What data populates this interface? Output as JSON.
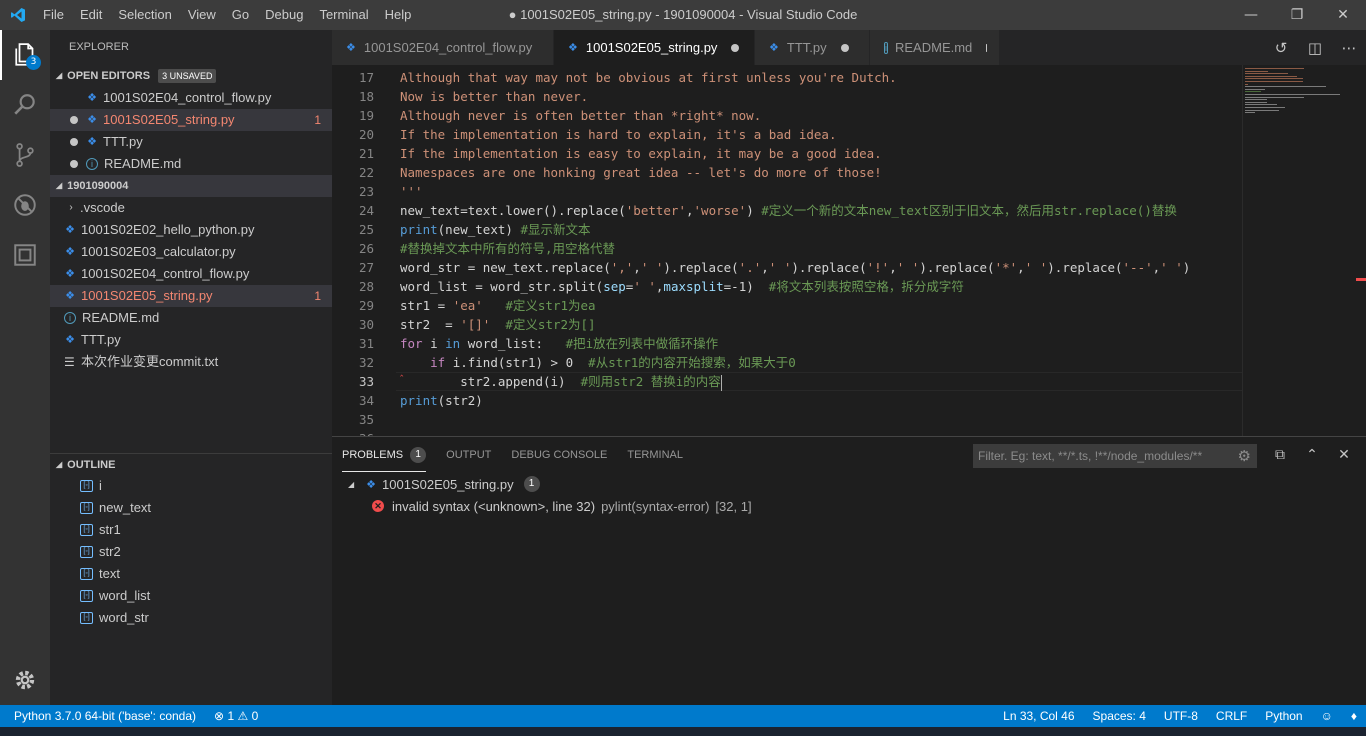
{
  "window": {
    "title": "● 1001S02E05_string.py - 1901090004 - Visual Studio Code",
    "menu": [
      "File",
      "Edit",
      "Selection",
      "View",
      "Go",
      "Debug",
      "Terminal",
      "Help"
    ]
  },
  "activity": {
    "explorer_badge": "3"
  },
  "sidebar": {
    "title": "EXPLORER",
    "open_editors": {
      "label": "OPEN EDITORS",
      "badge": "3 UNSAVED",
      "items": [
        {
          "name": "1001S02E04_control_flow.py",
          "error": "",
          "dirty": false
        },
        {
          "name": "1001S02E05_string.py",
          "error": "1",
          "dirty": true
        },
        {
          "name": "TTT.py",
          "error": "",
          "dirty": true
        },
        {
          "name": "README.md",
          "error": "",
          "dirty": true
        }
      ]
    },
    "workspace": {
      "label": "1901090004",
      "items": [
        {
          "name": ".vscode",
          "error": ""
        },
        {
          "name": "1001S02E02_hello_python.py",
          "error": ""
        },
        {
          "name": "1001S02E03_calculator.py",
          "error": ""
        },
        {
          "name": "1001S02E04_control_flow.py",
          "error": ""
        },
        {
          "name": "1001S02E05_string.py",
          "error": "1"
        },
        {
          "name": "README.md",
          "error": ""
        },
        {
          "name": "TTT.py",
          "error": ""
        },
        {
          "name": "本次作业变更commit.txt",
          "error": ""
        }
      ]
    },
    "outline": {
      "label": "OUTLINE",
      "items": [
        "i",
        "new_text",
        "str1",
        "str2",
        "text",
        "word_list",
        "word_str"
      ]
    }
  },
  "tabs": [
    {
      "name": "1001S02E04_control_flow.py",
      "active": false,
      "dirty": false
    },
    {
      "name": "1001S02E05_string.py",
      "active": true,
      "dirty": true
    },
    {
      "name": "TTT.py",
      "active": false,
      "dirty": true
    },
    {
      "name": "README.md",
      "active": false,
      "dirty": true
    }
  ],
  "editor": {
    "lines": [
      {
        "n": "17",
        "parts": [
          [
            "doc",
            "Although that way may not be obvious at first unless you're Dutch."
          ]
        ]
      },
      {
        "n": "18",
        "parts": [
          [
            "doc",
            "Now is better than never."
          ]
        ]
      },
      {
        "n": "19",
        "parts": [
          [
            "doc",
            "Although never is often better than *right* now."
          ]
        ]
      },
      {
        "n": "20",
        "parts": [
          [
            "doc",
            "If the implementation is hard to explain, it's a bad idea."
          ]
        ]
      },
      {
        "n": "21",
        "parts": [
          [
            "doc",
            "If the implementation is easy to explain, it may be a good idea."
          ]
        ]
      },
      {
        "n": "22",
        "parts": [
          [
            "doc",
            "Namespaces are one honking great idea -- let's do more of those!"
          ]
        ]
      },
      {
        "n": "23",
        "parts": [
          [
            "doc",
            "'''"
          ]
        ]
      },
      {
        "n": "24",
        "parts": [
          [
            "t",
            "new_text=text.lower().replace("
          ],
          [
            "s",
            "'better'"
          ],
          [
            "t",
            ","
          ],
          [
            "s",
            "'worse'"
          ],
          [
            "t",
            ") "
          ],
          [
            "c",
            "#定义一个新的文本new_text区别于旧文本，然后用str.replace()替换"
          ]
        ]
      },
      {
        "n": "25",
        "parts": [
          [
            "k",
            "print"
          ],
          [
            "t",
            "(new_text) "
          ],
          [
            "c",
            "#显示新文本"
          ]
        ]
      },
      {
        "n": "26",
        "parts": [
          [
            "c",
            "#替换掉文本中所有的符号,用空格代替"
          ]
        ]
      },
      {
        "n": "27",
        "parts": [
          [
            "t",
            "word_str = new_text.replace("
          ],
          [
            "s",
            "','"
          ],
          [
            "t",
            ","
          ],
          [
            "s",
            "' '"
          ],
          [
            "t",
            ").replace("
          ],
          [
            "s",
            "'.'"
          ],
          [
            "t",
            ","
          ],
          [
            "s",
            "' '"
          ],
          [
            "t",
            ").replace("
          ],
          [
            "s",
            "'!'"
          ],
          [
            "t",
            ","
          ],
          [
            "s",
            "' '"
          ],
          [
            "t",
            ").replace("
          ],
          [
            "s",
            "'*'"
          ],
          [
            "t",
            ","
          ],
          [
            "s",
            "' '"
          ],
          [
            "t",
            ").replace("
          ],
          [
            "s",
            "'--'"
          ],
          [
            "t",
            ","
          ],
          [
            "s",
            "' '"
          ],
          [
            "t",
            ")"
          ]
        ]
      },
      {
        "n": "28",
        "parts": [
          [
            "t",
            "word_list = word_str.split("
          ],
          [
            "p",
            "sep"
          ],
          [
            "t",
            "="
          ],
          [
            "s",
            "' '"
          ],
          [
            "t",
            ","
          ],
          [
            "p",
            "maxsplit"
          ],
          [
            "t",
            "=-1)  "
          ],
          [
            "c",
            "#将文本列表按照空格，拆分成字符"
          ]
        ]
      },
      {
        "n": "29",
        "parts": [
          [
            "t",
            "str1 = "
          ],
          [
            "s",
            "'ea'"
          ],
          [
            "t",
            "   "
          ],
          [
            "c",
            "#定义str1为ea"
          ]
        ]
      },
      {
        "n": "30",
        "parts": [
          [
            "t",
            "str2  = "
          ],
          [
            "s",
            "'[]'"
          ],
          [
            "t",
            "  "
          ],
          [
            "c",
            "#定义str2为[]"
          ]
        ]
      },
      {
        "n": "31",
        "parts": [
          [
            "kc",
            "for"
          ],
          [
            "t",
            " i "
          ],
          [
            "k",
            "in"
          ],
          [
            "t",
            " word_list:   "
          ],
          [
            "c",
            "#把i放在列表中做循环操作"
          ]
        ]
      },
      {
        "n": "32",
        "parts": [
          [
            "t",
            "    "
          ],
          [
            "kc",
            "if"
          ],
          [
            "t",
            " i.find(str1) > 0  "
          ],
          [
            "c",
            "#从str1的内容开始搜索，如果大于0"
          ]
        ]
      },
      {
        "n": "33",
        "parts": [
          [
            "t",
            "        str2.append(i)  "
          ],
          [
            "c",
            "#则用str2 替换i的内容"
          ]
        ]
      },
      {
        "n": "34",
        "parts": [
          [
            "k",
            "print"
          ],
          [
            "t",
            "(str2)"
          ]
        ]
      },
      {
        "n": "35",
        "parts": []
      },
      {
        "n": "36",
        "parts": []
      }
    ],
    "current_line": "33"
  },
  "panel": {
    "tabs": [
      {
        "label": "PROBLEMS",
        "count": "1",
        "active": true
      },
      {
        "label": "OUTPUT",
        "count": "",
        "active": false
      },
      {
        "label": "DEBUG CONSOLE",
        "count": "",
        "active": false
      },
      {
        "label": "TERMINAL",
        "count": "",
        "active": false
      }
    ],
    "filter_placeholder": "Filter. Eg: text, **/*.ts, !**/node_modules/**",
    "problem_file": "1001S02E05_string.py",
    "problem_file_count": "1",
    "problem": {
      "message": "invalid syntax (<unknown>, line 32)",
      "source": "pylint(syntax-error)",
      "location": "[32, 1]"
    }
  },
  "statusbar": {
    "interpreter": "Python 3.7.0 64-bit ('base': conda)",
    "errors": "1",
    "warnings": "0",
    "position": "Ln 33, Col 46",
    "spaces": "Spaces: 4",
    "encoding": "UTF-8",
    "eol": "CRLF",
    "language": "Python"
  },
  "colors": {
    "accent": "#007acc",
    "error": "#f48771",
    "string": "#ce9178",
    "comment": "#6a9955",
    "keyword": "#569cd6"
  }
}
